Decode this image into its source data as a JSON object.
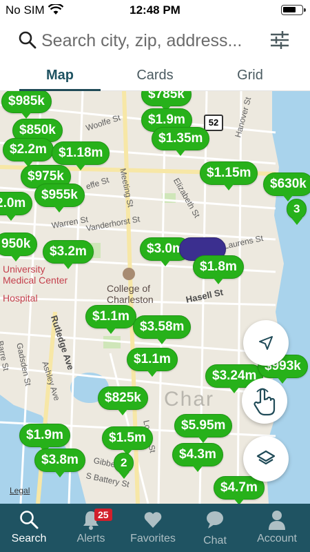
{
  "status_bar": {
    "carrier": "No SIM",
    "time": "12:48 PM"
  },
  "search": {
    "placeholder": "Search city, zip, address..."
  },
  "tabs": [
    {
      "label": "Map",
      "active": true
    },
    {
      "label": "Cards",
      "active": false
    },
    {
      "label": "Grid",
      "active": false
    }
  ],
  "map": {
    "route_badge": "52",
    "city_watermark": "Char",
    "legal": "Legal",
    "streets": {
      "woolfe": "Woolfe St",
      "meeting": "Meeting St",
      "elizabeth": "Elizabeth St",
      "hanover": "Hanover St",
      "ceffe": "effe St",
      "warren": "Warren St",
      "vanderhorst": "Vanderhorst St",
      "laurens": "Laurens St",
      "hasell": "Hasell St",
      "rutledge": "Rutledge Ave",
      "ashley": "Ashley Ave",
      "barre": "Barre St",
      "gadsden": "Gadsden St",
      "logan": "Logan St",
      "gibbes": "Gibbes St",
      "battery": "S Battery St",
      "re": "Re"
    },
    "places": {
      "college_line1": "College of",
      "college_line2": "Charleston",
      "university_line1": "University",
      "university_line2": "Medical Center",
      "hospital": "Hospital"
    },
    "pins": [
      {
        "label": "$785k",
        "color": "green"
      },
      {
        "label": "$985k",
        "color": "green"
      },
      {
        "label": "$1.9m",
        "color": "green"
      },
      {
        "label": "$850k",
        "color": "green"
      },
      {
        "label": "$1.35m",
        "color": "green"
      },
      {
        "label": "$2.2m",
        "color": "green"
      },
      {
        "label": "$1.18m",
        "color": "green"
      },
      {
        "label": "$975k",
        "color": "green"
      },
      {
        "label": "$955k",
        "color": "green"
      },
      {
        "label": "$1.15m",
        "color": "green"
      },
      {
        "label": "$630k",
        "color": "green"
      },
      {
        "label": "3",
        "color": "green"
      },
      {
        "label": "2.0m",
        "color": "green"
      },
      {
        "label": "950k",
        "color": "green"
      },
      {
        "label": "$3.2m",
        "color": "green"
      },
      {
        "label": "$3.0m",
        "color": "green"
      },
      {
        "label": "$1.8m",
        "color": "green"
      },
      {
        "label": "$1.1m",
        "color": "green"
      },
      {
        "label": "$3.58m",
        "color": "green"
      },
      {
        "label": "$1.1m",
        "color": "green"
      },
      {
        "label": "$3.24m",
        "color": "green"
      },
      {
        "label": "$993k",
        "color": "green"
      },
      {
        "label": "$825k",
        "color": "green"
      },
      {
        "label": "$1.9m",
        "color": "green"
      },
      {
        "label": "$1.5m",
        "color": "green"
      },
      {
        "label": "$5.95m",
        "color": "green"
      },
      {
        "label": "$4.3m",
        "color": "green"
      },
      {
        "label": "$3.8m",
        "color": "green"
      },
      {
        "label": "2",
        "color": "green"
      },
      {
        "label": "$4.7m",
        "color": "green"
      }
    ]
  },
  "bottom_nav": [
    {
      "label": "Search",
      "active": true
    },
    {
      "label": "Alerts",
      "active": false,
      "badge": "25"
    },
    {
      "label": "Favorites",
      "active": false
    },
    {
      "label": "Chat",
      "active": false
    },
    {
      "label": "Account",
      "active": false
    }
  ],
  "colors": {
    "pin_green": "#27b11a",
    "pin_purple": "#3b2f8f",
    "nav_bg": "#1f5362",
    "badge_red": "#d21f2b",
    "water": "#a9d3ec"
  }
}
